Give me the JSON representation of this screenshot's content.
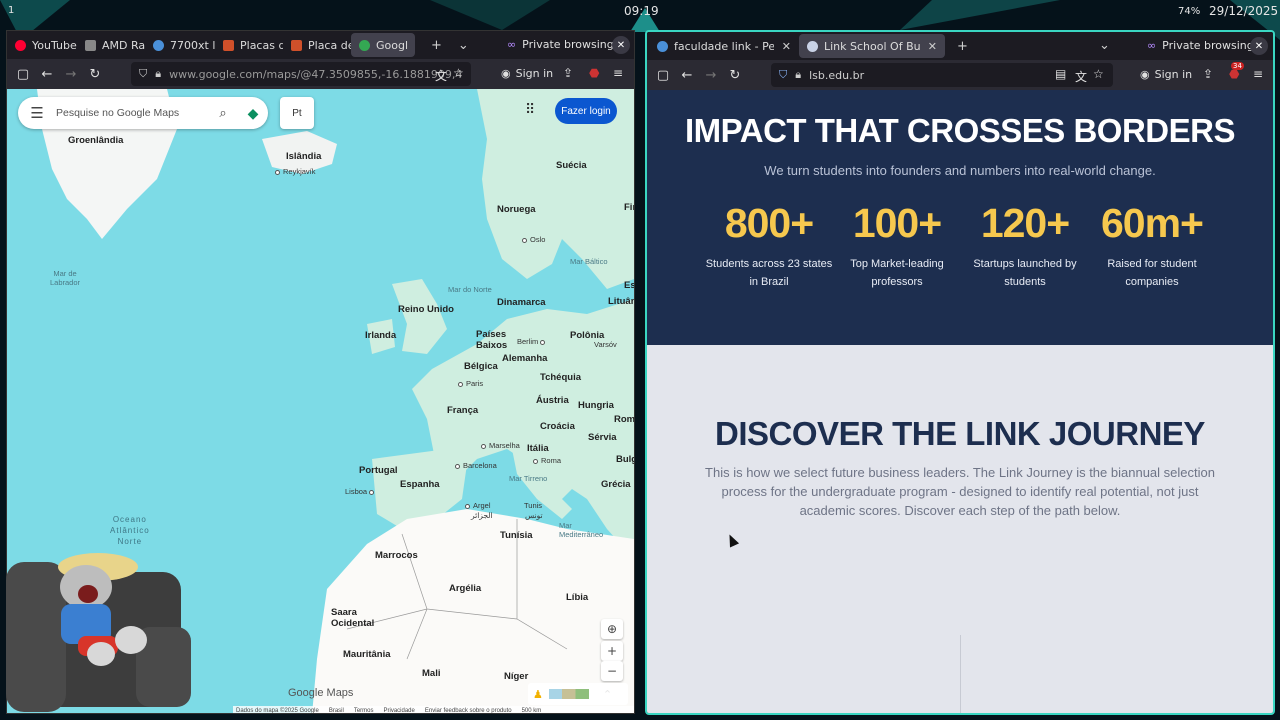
{
  "topbar": {
    "workspace": "1",
    "clock": "09:19",
    "battery": "74%",
    "date": "29/12/2025"
  },
  "left_window": {
    "tabs": [
      {
        "label": "YouTube",
        "color": "#ff0033"
      },
      {
        "label": "AMD Ra",
        "color": "#888888"
      },
      {
        "label": "7700xt l",
        "color": "#4a90d9"
      },
      {
        "label": "Placas d",
        "color": "#d0502a"
      },
      {
        "label": "Placa de",
        "color": "#d0502a"
      },
      {
        "label": "Googl",
        "color": "#34a853"
      }
    ],
    "private_label": "Private browsing",
    "url": "www.google.com/maps/@47.3509855,-16.1881909,4",
    "signin": "Sign in",
    "map": {
      "search_placeholder": "Pesquise no Google Maps",
      "layer_button": "Pt",
      "login_button": "Fazer login",
      "labels": {
        "groenlandia": "Groenlândia",
        "islandia": "Islândia",
        "reykjavik": "Reykjavík",
        "suecia": "Suécia",
        "noruega": "Noruega",
        "fin": "Fin",
        "oslo": "Oslo",
        "es": "Es",
        "mar_labrador": "Mar de\nLabrador",
        "mar_norte": "Mar do Norte",
        "mar_baltico": "Mar Báltico",
        "dinamarca": "Dinamarca",
        "lituan": "Lituân",
        "reino_unido": "Reino Unido",
        "irlanda": "Irlanda",
        "paises_baixos": "Países\nBaixos",
        "berlim": "Berlim",
        "polonia": "Polônia",
        "varsov": "Varsóv",
        "belgica": "Bélgica",
        "alemanha": "Alemanha",
        "paris": "Paris",
        "tchequia": "Tchéquia",
        "austria": "Áustria",
        "hungria": "Hungria",
        "rom": "Rom",
        "franca": "França",
        "croacia": "Croácia",
        "servia": "Sérvia",
        "marselha": "Marselha",
        "italia": "Itália",
        "bulg": "Bulg",
        "roma": "Roma",
        "portugal": "Portugal",
        "barcelona": "Barcelona",
        "espanha": "Espanha",
        "grecia": "Grécia",
        "lisboa": "Lisboa",
        "mar_tirreno": "Mar Tirreno",
        "argel": "Argel",
        "argel_ar": "الجزائر",
        "tunis": "Tunis",
        "tunis_ar": "تونس",
        "mar_mediterraneo": "Mar\nMediterrâneo",
        "tunisia": "Tunísia",
        "oceano": "Oceano\nAtlântico\nNorte",
        "marrocos": "Marrocos",
        "argelia": "Argélia",
        "libia": "Líbia",
        "saara": "Saara\nOcidental",
        "mauritania": "Mauritânia",
        "mali": "Mali",
        "niger": "Níger"
      },
      "google_logo": "Google Maps",
      "footer": [
        "Dados do mapa ©2025 Google",
        "Brasil",
        "Termos",
        "Privacidade",
        "Enviar feedback sobre o produto",
        "500 km"
      ]
    }
  },
  "right_window": {
    "tabs": [
      {
        "label": "faculdade link - Pesquis",
        "color": "#4a90d9"
      },
      {
        "label": "Link School Of Business",
        "color": "#1d2e4f"
      }
    ],
    "private_label": "Private browsing",
    "url": "lsb.edu.br",
    "signin": "Sign in",
    "ext_badge": "34",
    "impact": {
      "title": "IMPACT THAT CROSSES BORDERS",
      "subtitle": "We turn students into founders and numbers into real-world change.",
      "stats": [
        {
          "num": "800+",
          "label": "Students across 23 states in Brazil"
        },
        {
          "num": "100+",
          "label": "Top Market-leading professors"
        },
        {
          "num": "120+",
          "label": "Startups launched by students"
        },
        {
          "num": "60m+",
          "label": "Raised for student companies"
        }
      ]
    },
    "journey": {
      "title": "DISCOVER THE LINK JOURNEY",
      "text": "This is how we select future business leaders. The Link Journey is the biannual selection process for the undergraduate program - designed to identify real potential, not just academic scores. Discover each step of the path below."
    }
  },
  "colors": {
    "accent_border": "#3ad6c2",
    "navy": "#1d2e4f",
    "gold": "#f6c84e",
    "sea": "#7ddbe6",
    "land": "#cfeee0"
  }
}
